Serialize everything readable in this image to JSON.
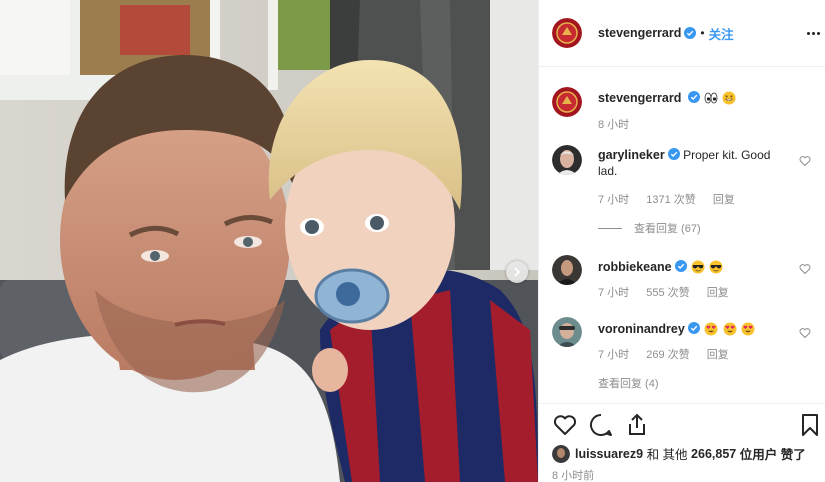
{
  "post": {
    "author": "stevengerrard",
    "dot": "•",
    "follow_label": "关注",
    "next_icon": "chevron-right-icon",
    "more_icon": "more-horizontal-icon"
  },
  "comments": [
    {
      "username": "stevengerrard",
      "text": "",
      "emojis": [
        "eyes",
        "grinning"
      ],
      "time": "8 小时",
      "likes": "",
      "reply": ""
    },
    {
      "username": "garylineker",
      "text": "Proper kit. Good lad.",
      "time": "7 小时",
      "likes": "1371 次赞",
      "reply": "回复",
      "view_replies": "查看回复 (67)"
    },
    {
      "username": "robbiekeane",
      "text": "",
      "emojis": [
        "sunglasses",
        "sunglasses"
      ],
      "time": "7 小时",
      "likes": "555 次赞",
      "reply": "回复"
    },
    {
      "username": "voroninandrey",
      "text": "",
      "emojis": [
        "heart-eyes",
        "heart-eyes",
        "heart-eyes"
      ],
      "time": "7 小时",
      "likes": "269 次赞",
      "reply": "回复",
      "view_replies": "查看回复 (4)"
    }
  ],
  "footer": {
    "liker": "luissuarez9",
    "and_others": "和 其他",
    "count": "266,857",
    "suffix": "位用户 赞了",
    "time": "8 小时前",
    "icons": [
      "heart-icon",
      "comment-icon",
      "share-icon",
      "bookmark-icon"
    ]
  },
  "colors": {
    "accent": "#3897f0",
    "muted": "#8e8e8e",
    "text": "#262626",
    "verified": "#3897f0"
  }
}
